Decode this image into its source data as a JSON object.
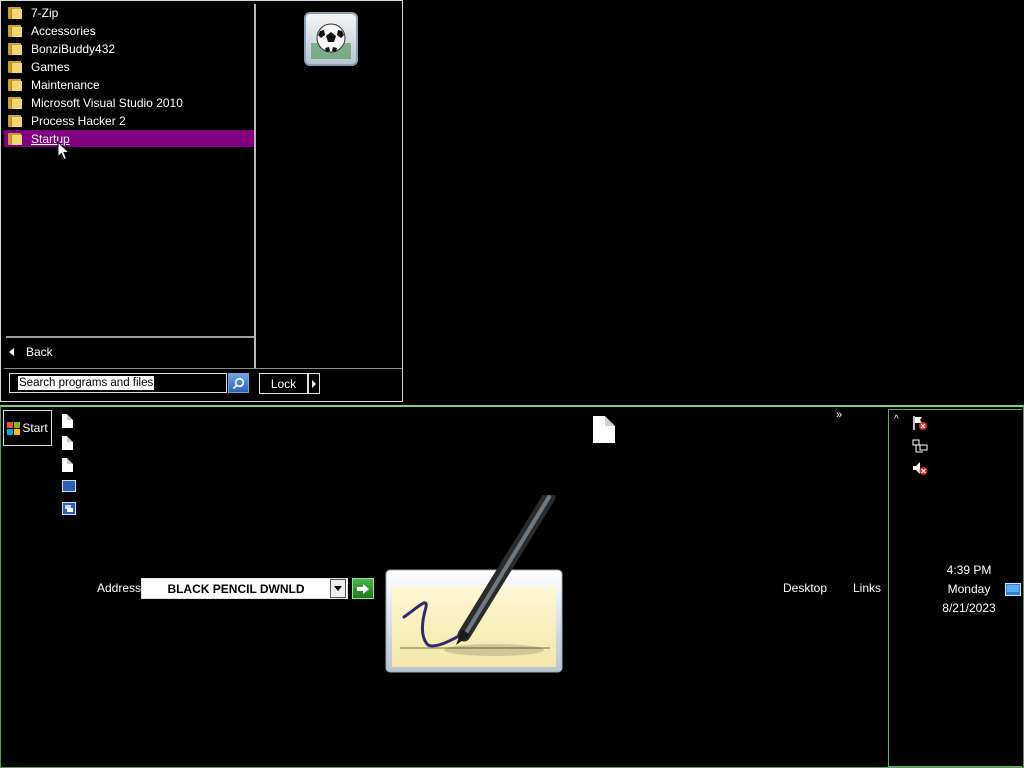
{
  "start_menu": {
    "programs": [
      {
        "label": "7-Zip",
        "selected": false
      },
      {
        "label": "Accessories",
        "selected": false
      },
      {
        "label": "BonziBuddy432",
        "selected": false
      },
      {
        "label": "Games",
        "selected": false
      },
      {
        "label": "Maintenance",
        "selected": false
      },
      {
        "label": "Microsoft Visual Studio 2010",
        "selected": false
      },
      {
        "label": "Process Hacker 2",
        "selected": false
      },
      {
        "label": "Startup",
        "selected": true
      }
    ],
    "back_label": "Back",
    "search_placeholder": "Search programs and files",
    "lock_label": "Lock",
    "user_picture_icon": "soccer-ball-icon",
    "highlight_color": "#800080"
  },
  "taskbar": {
    "start_label": "Start",
    "quick_launch_icons": [
      "document-icon",
      "document-icon",
      "document-icon",
      "show-desktop-icon",
      "switch-windows-icon"
    ],
    "chevron": "»",
    "address_label": "Address",
    "address_value": "BLACK PENCIL DWNLD",
    "desktop_label": "Desktop",
    "links_label": "Links",
    "accent_color": "#7bd07b"
  },
  "tray": {
    "expand": "^",
    "icons": [
      "action-center-flag-icon",
      "network-icon",
      "volume-muted-icon"
    ],
    "time": "4:39 PM",
    "day": "Monday",
    "date": "8/21/2023"
  }
}
